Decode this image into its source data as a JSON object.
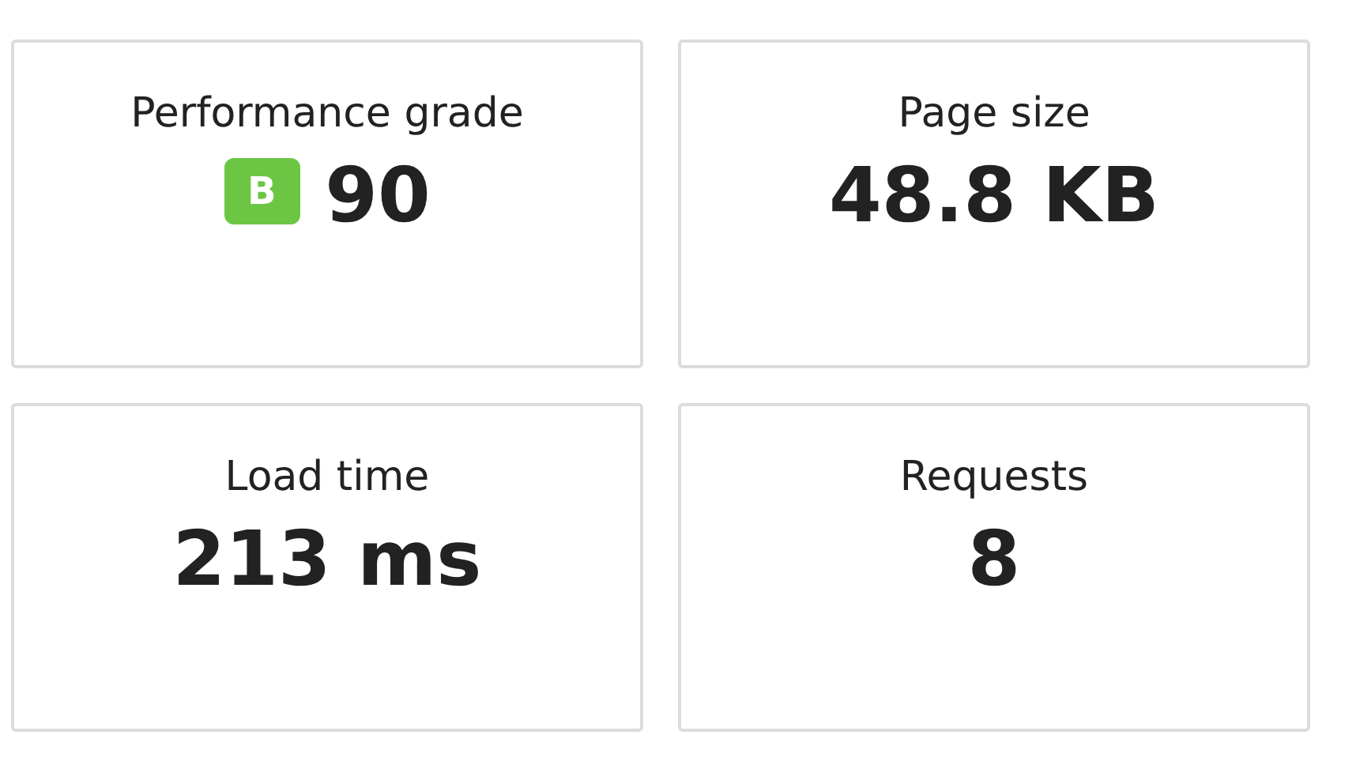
{
  "metrics": [
    {
      "kind": "grade",
      "label": "Performance grade",
      "grade": "B",
      "value": "90"
    },
    {
      "kind": "plain",
      "label": "Page size",
      "value": "48.8 KB"
    },
    {
      "kind": "plain",
      "label": "Load time",
      "value": "213 ms"
    },
    {
      "kind": "plain",
      "label": "Requests",
      "value": "8"
    }
  ]
}
